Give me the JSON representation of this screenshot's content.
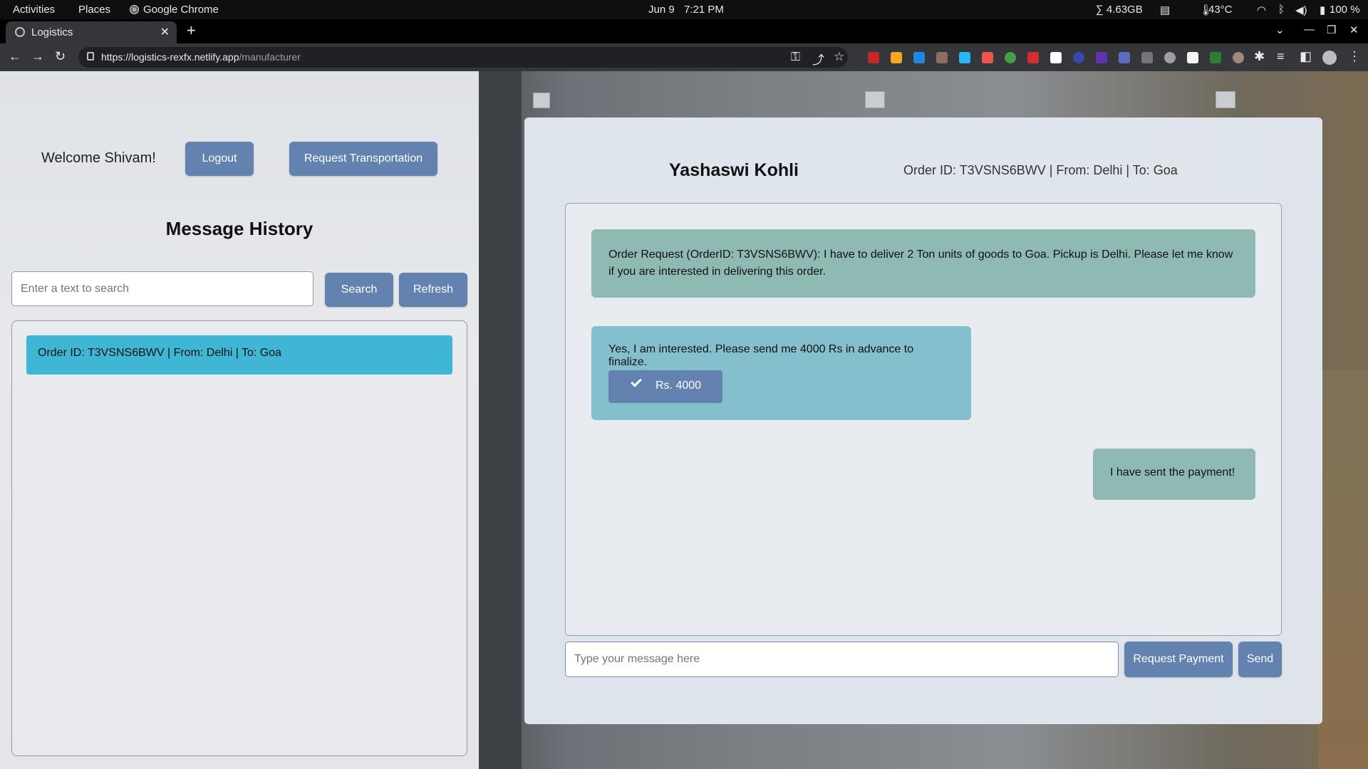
{
  "topbar": {
    "activities": "Activities",
    "places": "Places",
    "app": "Google Chrome",
    "date": "Jun 9",
    "time": "7:21 PM",
    "memory": "∑ 4.63GB",
    "temperature": "43°C",
    "battery": "100 %"
  },
  "browser": {
    "tab_title": "Logistics",
    "url_host": "https://logistics-rexfx.netlify.app",
    "url_path": "/manufacturer"
  },
  "left": {
    "welcome": "Welcome Shivam!",
    "logout_label": "Logout",
    "request_transport_label": "Request Transportation",
    "heading": "Message History",
    "search_placeholder": "Enter a text to search",
    "search_label": "Search",
    "refresh_label": "Refresh",
    "history": [
      {
        "label": "Order ID: T3VSNS6BWV | From: Delhi | To: Goa"
      }
    ]
  },
  "chat": {
    "contact_name": "Yashaswi Kohli",
    "order_meta": "Order ID: T3VSNS6BWV | From: Delhi | To: Goa",
    "messages": [
      {
        "text": "Order Request (OrderID: T3VSNS6BWV): I have to deliver 2 Ton units of goods to Goa. Pickup is Delhi. Please let me know if you are interested in delivering this order."
      },
      {
        "text": "Yes, I am interested. Please send me 4000 Rs in advance to finalize.",
        "payment_label": "Rs. 4000"
      },
      {
        "text": "I have sent the payment!"
      }
    ],
    "input_placeholder": "Type your message here",
    "request_payment_label": "Request Payment",
    "send_label": "Send"
  },
  "colors": {
    "accent_button": "#6382b0",
    "history_item": "#3fb6d4",
    "bubble_green": "#8ebab3",
    "bubble_blue": "#84bfcd"
  }
}
